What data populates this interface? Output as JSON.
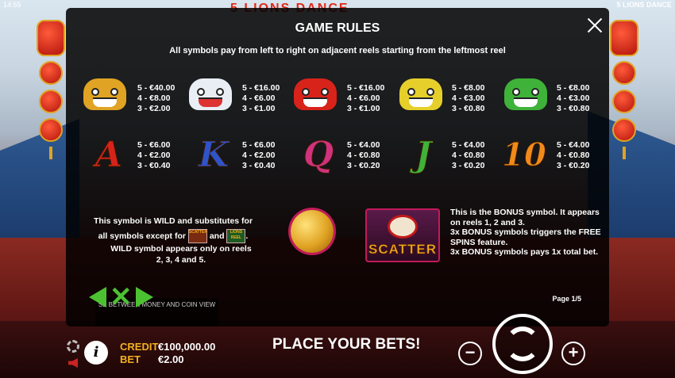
{
  "status": {
    "time": "14:55",
    "game_name": "5 LIONS DANCE"
  },
  "logo_text": "5 LIONS DANCE",
  "rules": {
    "title": "GAME RULES",
    "subtitle": "All symbols pay from left to right on adjacent reels starting from the leftmost reel",
    "symbols": [
      {
        "name": "gold-lion",
        "color": "#e0a323",
        "pays": "5 - €40.00\n4 - €8.00\n3 - €2.00"
      },
      {
        "name": "white-lion",
        "color": "#e8eef4",
        "pays": "5 - €16.00\n4 - €6.00\n3 - €1.00"
      },
      {
        "name": "red-lion",
        "color": "#d8231a",
        "pays": "5 - €16.00\n4 - €6.00\n3 - €1.00"
      },
      {
        "name": "yellow-lion",
        "color": "#e6cf2a",
        "pays": "5 - €8.00\n4 - €3.00\n3 - €0.80"
      },
      {
        "name": "green-lion",
        "color": "#3fb239",
        "pays": "5 - €8.00\n4 - €3.00\n3 - €0.80"
      },
      {
        "name": "A",
        "color": "#d8231a",
        "pays": "5 - €6.00\n4 - €2.00\n3 - €0.40"
      },
      {
        "name": "K",
        "color": "#2f53c8",
        "pays": "5 - €6.00\n4 - €2.00\n3 - €0.40"
      },
      {
        "name": "Q",
        "color": "#d0327e",
        "pays": "5 - €4.00\n4 - €0.80\n3 - €0.20"
      },
      {
        "name": "J",
        "color": "#3fb239",
        "pays": "5 - €4.00\n4 - €0.80\n3 - €0.20"
      },
      {
        "name": "10",
        "color": "#f08a1a",
        "pays": "5 - €4.00\n4 - €0.80\n3 - €0.20"
      }
    ],
    "wild": {
      "line1": "This symbol is WILD and substitutes for",
      "line2_prefix": "all symbols except for",
      "line2_and": "and",
      "line2_suffix": ".",
      "line3": "WILD symbol appears only on reels",
      "line4": "2, 3, 4 and 5.",
      "icon_scatter_text": "SCATTER",
      "icon_lions_text": "LIONS REEL"
    },
    "bonus": {
      "scatter_label": "SCATTER",
      "line1": "This is the BONUS symbol. It appears on reels 1, 2 and 3.",
      "line2": "3x BONUS symbols triggers the FREE SPINS feature.",
      "line3": "3x BONUS symbols pays 1x total bet."
    },
    "page": "Page 1/5"
  },
  "tooltip_text": "SE BETWEEN MONEY AND COIN VIEW",
  "footer": {
    "credit_label": "CREDIT",
    "credit_value": "€100,000.00",
    "bet_label": "BET",
    "bet_value": "€2.00",
    "message": "PLACE YOUR BETS!",
    "minus": "−",
    "plus": "+",
    "info": "i"
  }
}
